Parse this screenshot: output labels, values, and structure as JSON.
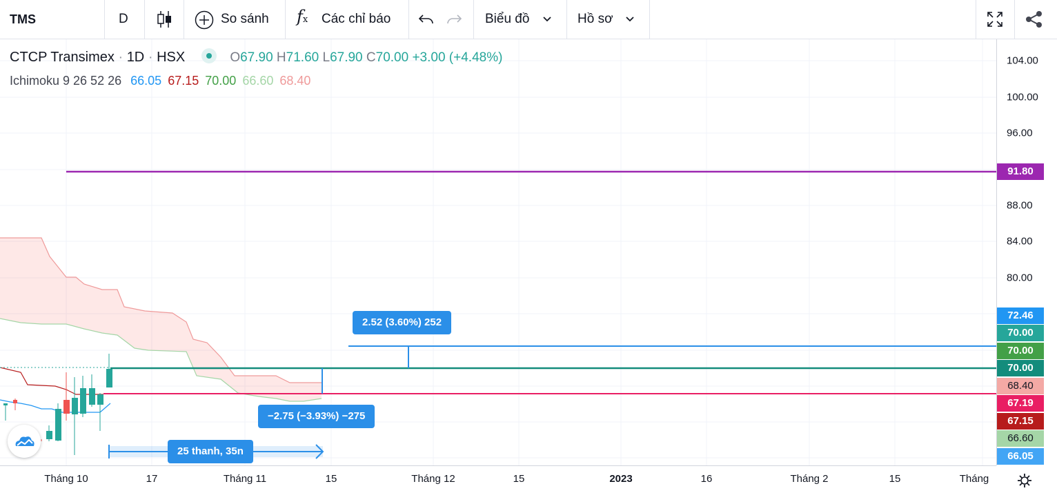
{
  "toolbar": {
    "symbol": "TMS",
    "interval": "D",
    "compare_label": "So sánh",
    "indicators_label": "Các chỉ báo",
    "chart_label": "Biểu đồ",
    "profile_label": "Hồ sơ"
  },
  "legend": {
    "company": "CTCP Transimex",
    "timeframe": "1D",
    "exchange": "HSX",
    "ohlc": {
      "o_label": "O",
      "o": "67.90",
      "h_label": "H",
      "h": "71.60",
      "l_label": "L",
      "l": "67.90",
      "c_label": "C",
      "c": "70.00",
      "change": "+3.00 (+4.48%)"
    },
    "indicator": {
      "name": "Ichimoku 9 26 52 26",
      "v1": "66.05",
      "v2": "67.15",
      "v3": "70.00",
      "v4": "66.60",
      "v5": "68.40"
    }
  },
  "price_axis": {
    "ticks": [
      "104.00",
      "100.00",
      "96.00",
      "88.00",
      "84.00",
      "80.00"
    ],
    "tags": [
      {
        "value": "91.80",
        "color": "#9c27b0"
      },
      {
        "value": "72.46",
        "color": "#2196f3"
      },
      {
        "value": "70.00",
        "color": "#26a69a"
      },
      {
        "value": "70.00",
        "color": "#43a047"
      },
      {
        "value": "70.00",
        "color": "#138c7c"
      },
      {
        "value": "68.40",
        "color": "#f4a9a5"
      },
      {
        "value": "67.19",
        "color": "#e91e63"
      },
      {
        "value": "67.15",
        "color": "#b71c1c"
      },
      {
        "value": "66.60",
        "color": "#a5d6a7"
      },
      {
        "value": "66.05",
        "color": "#42a5f5"
      }
    ]
  },
  "time_axis": {
    "ticks": [
      "Tháng 10",
      "17",
      "Tháng 11",
      "15",
      "Tháng 12",
      "15",
      "2023",
      "16",
      "Tháng 2",
      "15",
      "Tháng"
    ]
  },
  "measure": {
    "up_label": "2.52 (3.60%) 252",
    "down_label": "−2.75 (−3.93%) −275",
    "bars_label": "25 thanh, 35n"
  },
  "colors": {
    "up": "#26a69a",
    "down": "#ef5350",
    "accent": "#2b8fe8",
    "horizontal_line": "#9c27b0"
  }
}
